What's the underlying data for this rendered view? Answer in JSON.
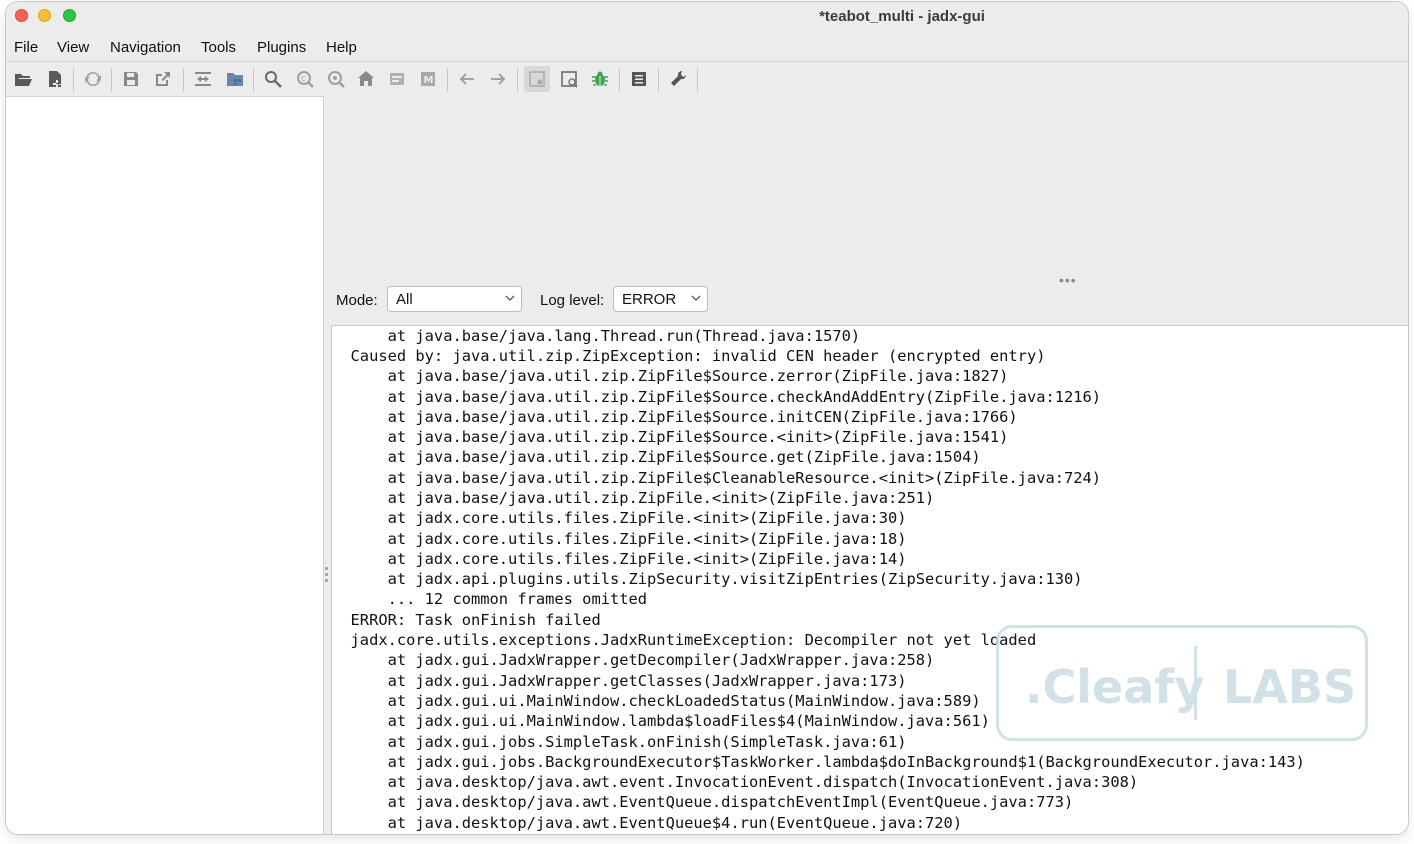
{
  "window": {
    "title": "*teabot_multi - jadx-gui"
  },
  "menubar": {
    "items": [
      "File",
      "View",
      "Navigation",
      "Tools",
      "Plugins",
      "Help"
    ]
  },
  "toolbar": {
    "icons": [
      "open-file-icon",
      "add-file-icon",
      "reload-icon",
      "save-all-icon",
      "export-icon",
      "sync-with-editor-icon",
      "flatten-packages-icon",
      "text-search-icon",
      "class-search-icon",
      "usage-search-icon",
      "home-icon",
      "deobfuscation-icon",
      "smali-icon",
      "back-icon",
      "forward-icon",
      "quark-icon",
      "decompile-all-icon",
      "debugger-icon",
      "log-viewer-icon",
      "preferences-icon"
    ]
  },
  "log_panel": {
    "mode_label": "Mode:",
    "mode_value": "All",
    "level_label": "Log level:",
    "level_value": "ERROR",
    "lines": [
      "      at java.base/java.lang.Thread.run(Thread.java:1570)",
      "  Caused by: java.util.zip.ZipException: invalid CEN header (encrypted entry)",
      "      at java.base/java.util.zip.ZipFile$Source.zerror(ZipFile.java:1827)",
      "      at java.base/java.util.zip.ZipFile$Source.checkAndAddEntry(ZipFile.java:1216)",
      "      at java.base/java.util.zip.ZipFile$Source.initCEN(ZipFile.java:1766)",
      "      at java.base/java.util.zip.ZipFile$Source.<init>(ZipFile.java:1541)",
      "      at java.base/java.util.zip.ZipFile$Source.get(ZipFile.java:1504)",
      "      at java.base/java.util.zip.ZipFile$CleanableResource.<init>(ZipFile.java:724)",
      "      at java.base/java.util.zip.ZipFile.<init>(ZipFile.java:251)",
      "      at jadx.core.utils.files.ZipFile.<init>(ZipFile.java:30)",
      "      at jadx.core.utils.files.ZipFile.<init>(ZipFile.java:18)",
      "      at jadx.core.utils.files.ZipFile.<init>(ZipFile.java:14)",
      "      at jadx.api.plugins.utils.ZipSecurity.visitZipEntries(ZipSecurity.java:130)",
      "      ... 12 common frames omitted",
      "  ERROR: Task onFinish failed",
      "  jadx.core.utils.exceptions.JadxRuntimeException: Decompiler not yet loaded",
      "      at jadx.gui.JadxWrapper.getDecompiler(JadxWrapper.java:258)",
      "      at jadx.gui.JadxWrapper.getClasses(JadxWrapper.java:173)",
      "      at jadx.gui.ui.MainWindow.checkLoadedStatus(MainWindow.java:589)",
      "      at jadx.gui.ui.MainWindow.lambda$loadFiles$4(MainWindow.java:561)",
      "      at jadx.gui.jobs.SimpleTask.onFinish(SimpleTask.java:61)",
      "      at jadx.gui.jobs.BackgroundExecutor$TaskWorker.lambda$doInBackground$1(BackgroundExecutor.java:143)",
      "      at java.desktop/java.awt.event.InvocationEvent.dispatch(InvocationEvent.java:308)",
      "      at java.desktop/java.awt.EventQueue.dispatchEventImpl(EventQueue.java:773)",
      "      at java.desktop/java.awt.EventQueue$4.run(EventQueue.java:720)"
    ]
  },
  "watermark": {
    "left": ".Cleafy",
    "right": "LABS"
  },
  "colors": {
    "watermark": "#c9dce5",
    "toolbar_icon": "#5a5a5a",
    "debug_icon": "#3fa34d"
  }
}
